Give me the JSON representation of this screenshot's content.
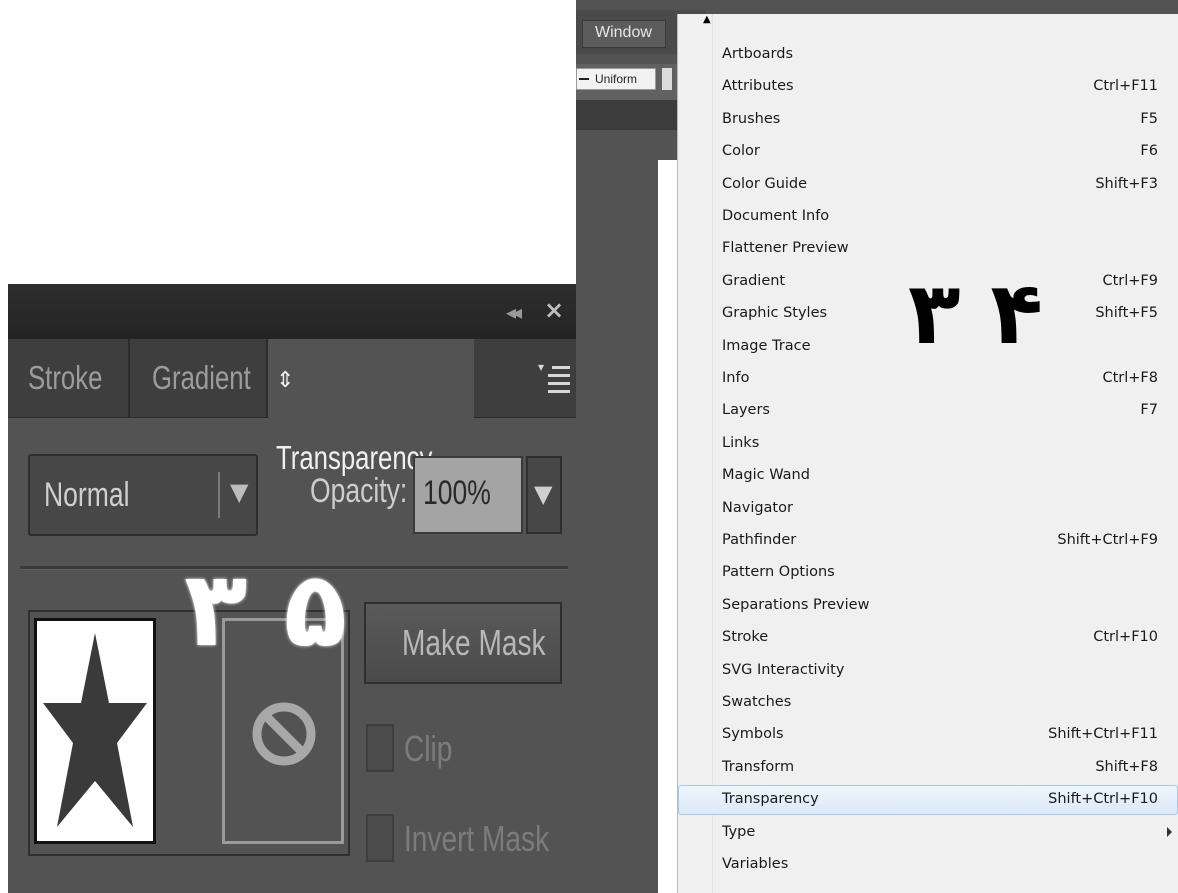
{
  "transparency_panel": {
    "tabs": [
      {
        "label": "Stroke"
      },
      {
        "label": "Gradient"
      },
      {
        "label": "Transparency",
        "active": true
      }
    ],
    "blend_mode": "Normal",
    "opacity_label": "Opacity:",
    "opacity_value": "100%",
    "make_mask_label": "Make Mask",
    "clip_label": "Clip",
    "invert_mask_label": "Invert Mask",
    "annotation": "۳ ۵"
  },
  "app_window": {
    "window_menu_label": "Window",
    "stroke_profile_value": "Uniform"
  },
  "window_menu": {
    "annotation": "۳ ۴",
    "highlighted_item": "Transparency",
    "items": [
      {
        "label": "Artboards",
        "shortcut": ""
      },
      {
        "label": "Attributes",
        "shortcut": "Ctrl+F11"
      },
      {
        "label": "Brushes",
        "shortcut": "F5"
      },
      {
        "label": "Color",
        "shortcut": "F6"
      },
      {
        "label": "Color Guide",
        "shortcut": "Shift+F3"
      },
      {
        "label": "Document Info",
        "shortcut": ""
      },
      {
        "label": "Flattener Preview",
        "shortcut": ""
      },
      {
        "label": "Gradient",
        "shortcut": "Ctrl+F9"
      },
      {
        "label": "Graphic Styles",
        "shortcut": "Shift+F5"
      },
      {
        "label": "Image Trace",
        "shortcut": ""
      },
      {
        "label": "Info",
        "shortcut": "Ctrl+F8"
      },
      {
        "label": "Layers",
        "shortcut": "F7"
      },
      {
        "label": "Links",
        "shortcut": ""
      },
      {
        "label": "Magic Wand",
        "shortcut": ""
      },
      {
        "label": "Navigator",
        "shortcut": ""
      },
      {
        "label": "Pathfinder",
        "shortcut": "Shift+Ctrl+F9"
      },
      {
        "label": "Pattern Options",
        "shortcut": ""
      },
      {
        "label": "Separations Preview",
        "shortcut": ""
      },
      {
        "label": "Stroke",
        "shortcut": "Ctrl+F10"
      },
      {
        "label": "SVG Interactivity",
        "shortcut": ""
      },
      {
        "label": "Swatches",
        "shortcut": ""
      },
      {
        "label": "Symbols",
        "shortcut": "Shift+Ctrl+F11"
      },
      {
        "label": "Transform",
        "shortcut": "Shift+F8"
      },
      {
        "label": "Transparency",
        "shortcut": "Shift+Ctrl+F10"
      },
      {
        "label": "Type",
        "shortcut": "",
        "submenu": true
      },
      {
        "label": "Variables",
        "shortcut": ""
      }
    ]
  },
  "colors": {
    "panel_bg": "#535353",
    "menu_bg": "#f0f0f0",
    "menu_highlight": "#dbe9f8"
  }
}
